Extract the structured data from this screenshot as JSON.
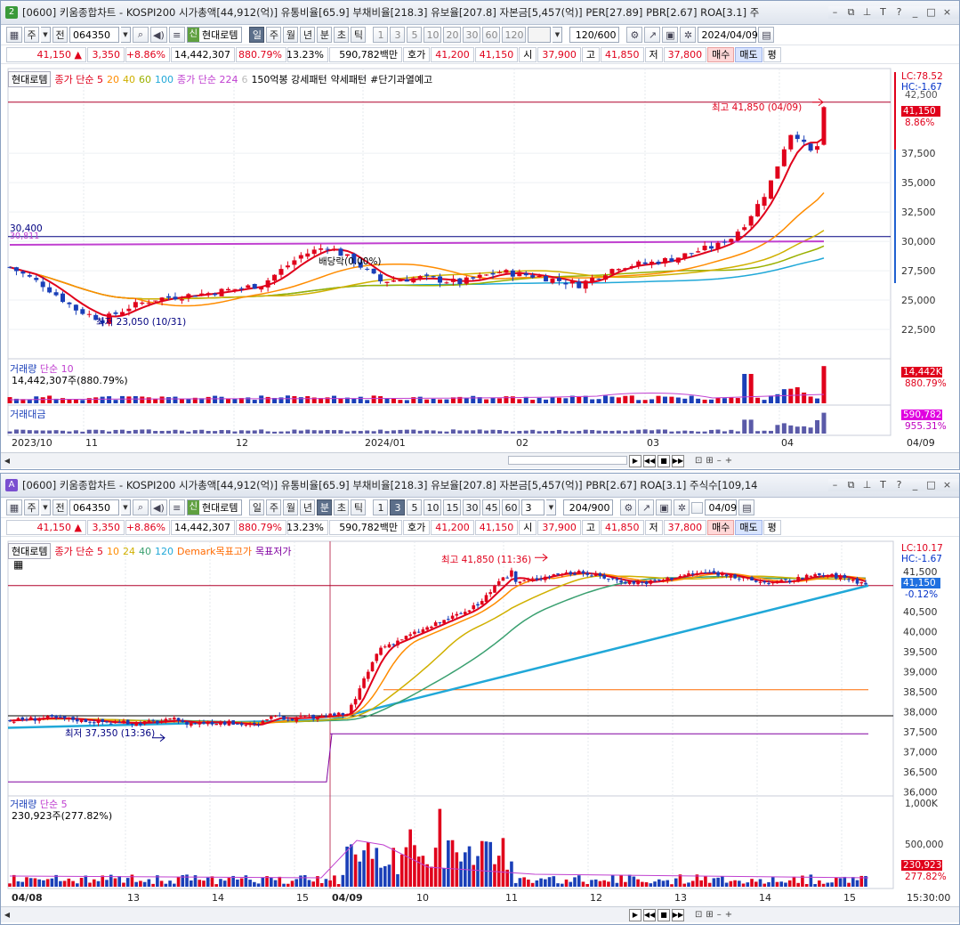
{
  "top": {
    "title": {
      "num": "2",
      "text": "[0600] 키움종합차트 - KOSPI200 시가총액[44,912(억)] 유통비율[65.9] 부채비율[218.3] 유보율[207.8] 자본금[5,457(억)] PER[27.89] PBR[2.67] ROA[3.1] 주"
    },
    "toolbar": {
      "b1": "주",
      "b2": "전",
      "code": "064350",
      "sig": "신",
      "name": "현대로템",
      "periods": [
        "일",
        "주",
        "월",
        "년",
        "분",
        "초",
        "틱"
      ],
      "nums": [
        "1",
        "3",
        "5",
        "10",
        "20",
        "30",
        "60",
        "120"
      ],
      "count": "120/600",
      "date": "2024/04/09"
    },
    "price": {
      "last": "41,150",
      "arrow": "▲",
      "change": "3,350",
      "pct": "+8.86%",
      "volume": "14,442,307",
      "volpct": "880.79%",
      "turn": "13.23%",
      "amount": "590,782백만",
      "ask_label": "호가",
      "ask1": "41,200",
      "ask2": "41,150",
      "open_label": "시",
      "open": "37,900",
      "high_label": "고",
      "high": "41,850",
      "low_label": "저",
      "low": "37,800",
      "buy": "매수",
      "sell": "매도",
      "eval": "평"
    },
    "legend": {
      "name": "현대로템",
      "ma_label": "종가 단순 5",
      "ma2": "20",
      "ma3": "40",
      "ma4": "60",
      "ma5": "100",
      "ma6_label": "종가 단순 224",
      "ma6b": "6",
      "pattern1": "150억봉 강세패턴",
      "pattern2": "약세패턴",
      "pattern3": "#단기과열예고"
    },
    "annotations": {
      "high": "최고 41,850 (04/09)",
      "low": "최저 23,050 (10/31)",
      "div": "배당락(0.00%)",
      "hline_a": "30,400",
      "hline_b": "30,811"
    },
    "right": {
      "lc": "LC:78.52",
      "hc": "HC:-1.67",
      "top": "42,500",
      "tag_price": "41,150",
      "tag_pct": "8.86%",
      "ticks": [
        "37,500",
        "35,000",
        "32,500",
        "30,000",
        "27,500",
        "25,000",
        "22,500"
      ]
    },
    "volume": {
      "label": "거래량",
      "ma": "단순 10",
      "value": "14,442,307주(880.79%)",
      "tag1": "14,442K",
      "tag2": "880.79%"
    },
    "amount_panel": {
      "label": "거래대금",
      "tag1": "590,782",
      "tag2": "955.31%"
    },
    "xaxis": [
      "2023/10",
      "11",
      "12",
      "2024/01",
      "02",
      "03",
      "04",
      "04/09"
    ],
    "colors": {
      "up": "#e0001b",
      "down": "#1a3fb8"
    }
  },
  "bottom": {
    "title": {
      "num": "A",
      "text": "[0600] 키움종합차트 - KOSPI200 시가총액[44,912(억)] 유통비율[65.9] 부채비율[218.3] 유보율[207.8] 자본금[5,457(억)] PBR[2.67] ROA[3.1] 주식수[109,14"
    },
    "toolbar": {
      "b1": "주",
      "b2": "전",
      "code": "064350",
      "sig": "신",
      "name": "현대로템",
      "periods": [
        "일",
        "주",
        "월",
        "년",
        "분",
        "초",
        "틱"
      ],
      "nums": [
        "1",
        "3",
        "5",
        "10",
        "15",
        "30",
        "45",
        "60"
      ],
      "sel": "3",
      "count": "204/900",
      "date": "04/09"
    },
    "price": {
      "last": "41,150",
      "arrow": "▲",
      "change": "3,350",
      "pct": "+8.86%",
      "volume": "14,442,307",
      "volpct": "880.79%",
      "turn": "13.23%",
      "amount": "590,782백만",
      "ask_label": "호가",
      "ask1": "41,200",
      "ask2": "41,150",
      "open_label": "시",
      "open": "37,900",
      "high_label": "고",
      "high": "41,850",
      "low_label": "저",
      "low": "37,800",
      "buy": "매수",
      "sell": "매도",
      "eval": "평"
    },
    "legend": {
      "name": "현대로템",
      "ma_label": "종가 단순 5",
      "ma2": "10",
      "ma3": "24",
      "ma4": "40",
      "ma5": "120",
      "demark1": "Demark목표고가",
      "demark2": "목표저가"
    },
    "annotations": {
      "high": "최고 41,850 (11:36)",
      "low": "최저 37,350 (13:36)"
    },
    "right": {
      "lc": "LC:10.17",
      "hc": "HC:-1.67",
      "tag_price": "41,150",
      "tag_pct": "-0.12%",
      "ticks": [
        "41,500",
        "40,500",
        "40,000",
        "39,500",
        "39,000",
        "38,500",
        "38,000",
        "37,500",
        "37,000",
        "36,500",
        "36,000"
      ]
    },
    "volume": {
      "label": "거래량",
      "ma": "단순 5",
      "value": "230,923주(277.82%)",
      "tick1": "1,000K",
      "tick2": "500,000",
      "tag1": "230,923",
      "tag2": "277.82%"
    },
    "xaxis": [
      "04/08",
      "13",
      "14",
      "15",
      "04/09",
      "10",
      "11",
      "12",
      "13",
      "14",
      "15",
      "15:30:00"
    ]
  }
}
